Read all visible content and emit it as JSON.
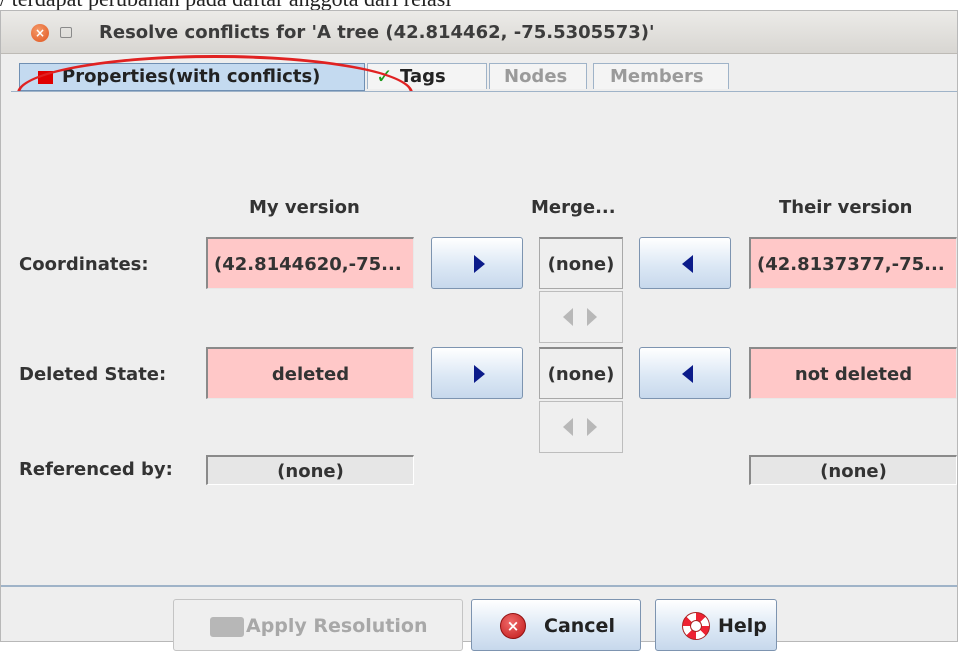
{
  "caption": "/ terdapat perubahan pada daftar anggota dari relasi",
  "window": {
    "title": "Resolve conflicts for 'A tree (42.814462, -75.5305573)'",
    "close_glyph": "×"
  },
  "tabs": [
    {
      "label": "Properties(with conflicts)",
      "state": "active",
      "icon": "conflict-red-square-icon"
    },
    {
      "label": "Tags",
      "state": "normal",
      "icon": "green-check-icon",
      "icon_glyph": "✓"
    },
    {
      "label": "Nodes",
      "state": "disabled"
    },
    {
      "label": "Members",
      "state": "disabled"
    }
  ],
  "columns": {
    "mine": "My version",
    "merged": "Merge...",
    "theirs": "Their version"
  },
  "rows": {
    "coordinates": {
      "label": "Coordinates:",
      "mine": "(42.8144620,-75...",
      "merged": "(none)",
      "theirs": "(42.8137377,-75..."
    },
    "deleted": {
      "label": "Deleted State:",
      "mine": "deleted",
      "merged": "(none)",
      "theirs": "not deleted"
    },
    "referenced": {
      "label": "Referenced by:",
      "mine": "(none)",
      "theirs": "(none)"
    }
  },
  "buttons": {
    "apply": "Apply Resolution",
    "cancel": "Cancel",
    "cancel_glyph": "×",
    "help": "Help"
  },
  "colors": {
    "conflict_field": "#ffc8c8",
    "active_tab": "#c4daf0",
    "annotation_circle": "#e02222",
    "arrow": "#0b1b8a"
  }
}
